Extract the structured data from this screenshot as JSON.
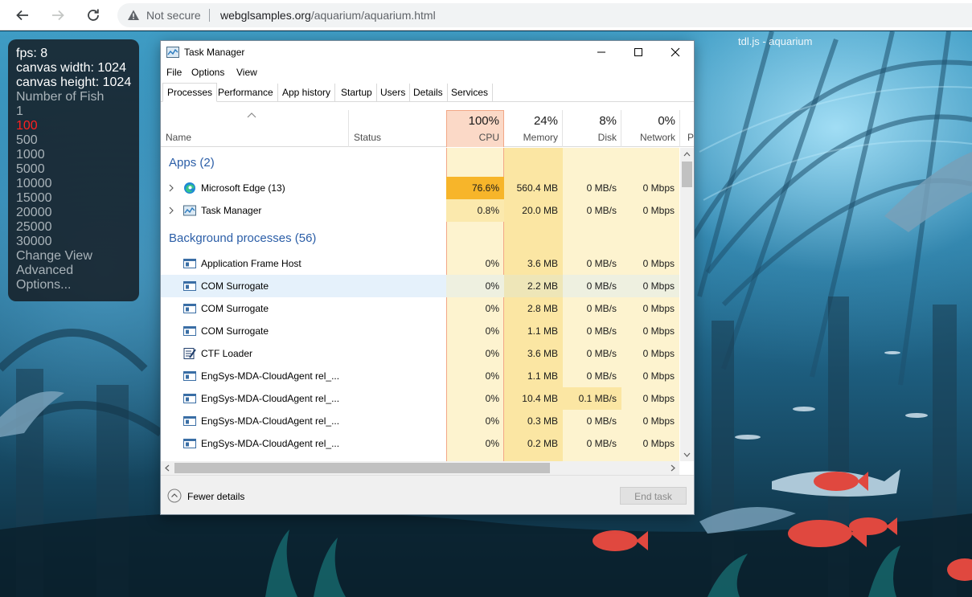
{
  "browser": {
    "nav": {
      "back_icon": "arrow-left-icon",
      "forward_icon": "arrow-right-icon",
      "reload_icon": "reload-icon"
    },
    "address": {
      "security_icon": "warning-triangle-icon",
      "status": "Not secure",
      "host": "webglsamples.org",
      "path": "/aquarium/aquarium.html"
    }
  },
  "aquarium": {
    "title": "tdl.js - aquarium",
    "panel": {
      "fps": "fps: 8",
      "canvas_width": "canvas width: 1024",
      "canvas_height": "canvas height: 1024",
      "number_of_fish_label": "Number of Fish",
      "fish_options": [
        "1",
        "100",
        "500",
        "1000",
        "5000",
        "10000",
        "15000",
        "20000",
        "25000",
        "30000"
      ],
      "selected_fish_option": "100",
      "change_view": "Change View",
      "advanced": "Advanced",
      "options": "Options..."
    }
  },
  "task_manager": {
    "title": "Task Manager",
    "menu": [
      "File",
      "Options",
      "View"
    ],
    "tabs": [
      "Processes",
      "Performance",
      "App history",
      "Startup",
      "Users",
      "Details",
      "Services"
    ],
    "active_tab": "Processes",
    "columns": {
      "name": "Name",
      "status": "Status",
      "cpu": {
        "pct": "100%",
        "label": "CPU"
      },
      "memory": {
        "pct": "24%",
        "label": "Memory"
      },
      "disk": {
        "pct": "8%",
        "label": "Disk"
      },
      "network": {
        "pct": "0%",
        "label": "Network"
      },
      "power_partial": "P"
    },
    "groups": {
      "apps": "Apps (2)",
      "background": "Background processes (56)"
    },
    "apps": [
      {
        "name": "Microsoft Edge (13)",
        "icon": "edge-icon",
        "cpu": "76.6%",
        "memory": "560.4 MB",
        "disk": "0 MB/s",
        "network": "0 Mbps"
      },
      {
        "name": "Task Manager",
        "icon": "task-manager-icon",
        "cpu": "0.8%",
        "memory": "20.0 MB",
        "disk": "0 MB/s",
        "network": "0 Mbps"
      }
    ],
    "background": [
      {
        "name": "Application Frame Host",
        "icon": "window-icon",
        "cpu": "0%",
        "memory": "3.6 MB",
        "disk": "0 MB/s",
        "network": "0 Mbps"
      },
      {
        "name": "COM Surrogate",
        "icon": "window-icon",
        "cpu": "0%",
        "memory": "2.2 MB",
        "disk": "0 MB/s",
        "network": "0 Mbps"
      },
      {
        "name": "COM Surrogate",
        "icon": "window-icon",
        "cpu": "0%",
        "memory": "2.8 MB",
        "disk": "0 MB/s",
        "network": "0 Mbps"
      },
      {
        "name": "COM Surrogate",
        "icon": "window-icon",
        "cpu": "0%",
        "memory": "1.1 MB",
        "disk": "0 MB/s",
        "network": "0 Mbps"
      },
      {
        "name": "CTF Loader",
        "icon": "ctf-loader-icon",
        "cpu": "0%",
        "memory": "3.6 MB",
        "disk": "0 MB/s",
        "network": "0 Mbps"
      },
      {
        "name": "EngSys-MDA-CloudAgent rel_...",
        "icon": "window-icon",
        "cpu": "0%",
        "memory": "1.1 MB",
        "disk": "0 MB/s",
        "network": "0 Mbps"
      },
      {
        "name": "EngSys-MDA-CloudAgent rel_...",
        "icon": "window-icon",
        "cpu": "0%",
        "memory": "10.4 MB",
        "disk": "0.1 MB/s",
        "network": "0 Mbps"
      },
      {
        "name": "EngSys-MDA-CloudAgent rel_...",
        "icon": "window-icon",
        "cpu": "0%",
        "memory": "0.3 MB",
        "disk": "0 MB/s",
        "network": "0 Mbps"
      },
      {
        "name": "EngSys-MDA-CloudAgent rel_...",
        "icon": "window-icon",
        "cpu": "0%",
        "memory": "0.2 MB",
        "disk": "0 MB/s",
        "network": "0 Mbps"
      }
    ],
    "footer": {
      "fewer_details": "Fewer details",
      "end_task": "End task"
    },
    "colors": {
      "cpu_hot": "#f7b52a",
      "cpu_mild": "#fbe9ad",
      "heat_light": "#fdf3cf",
      "heat_mid": "#fbe6a3",
      "group_text": "#2b5ea7",
      "selected_row": "#e5f1fb"
    }
  }
}
